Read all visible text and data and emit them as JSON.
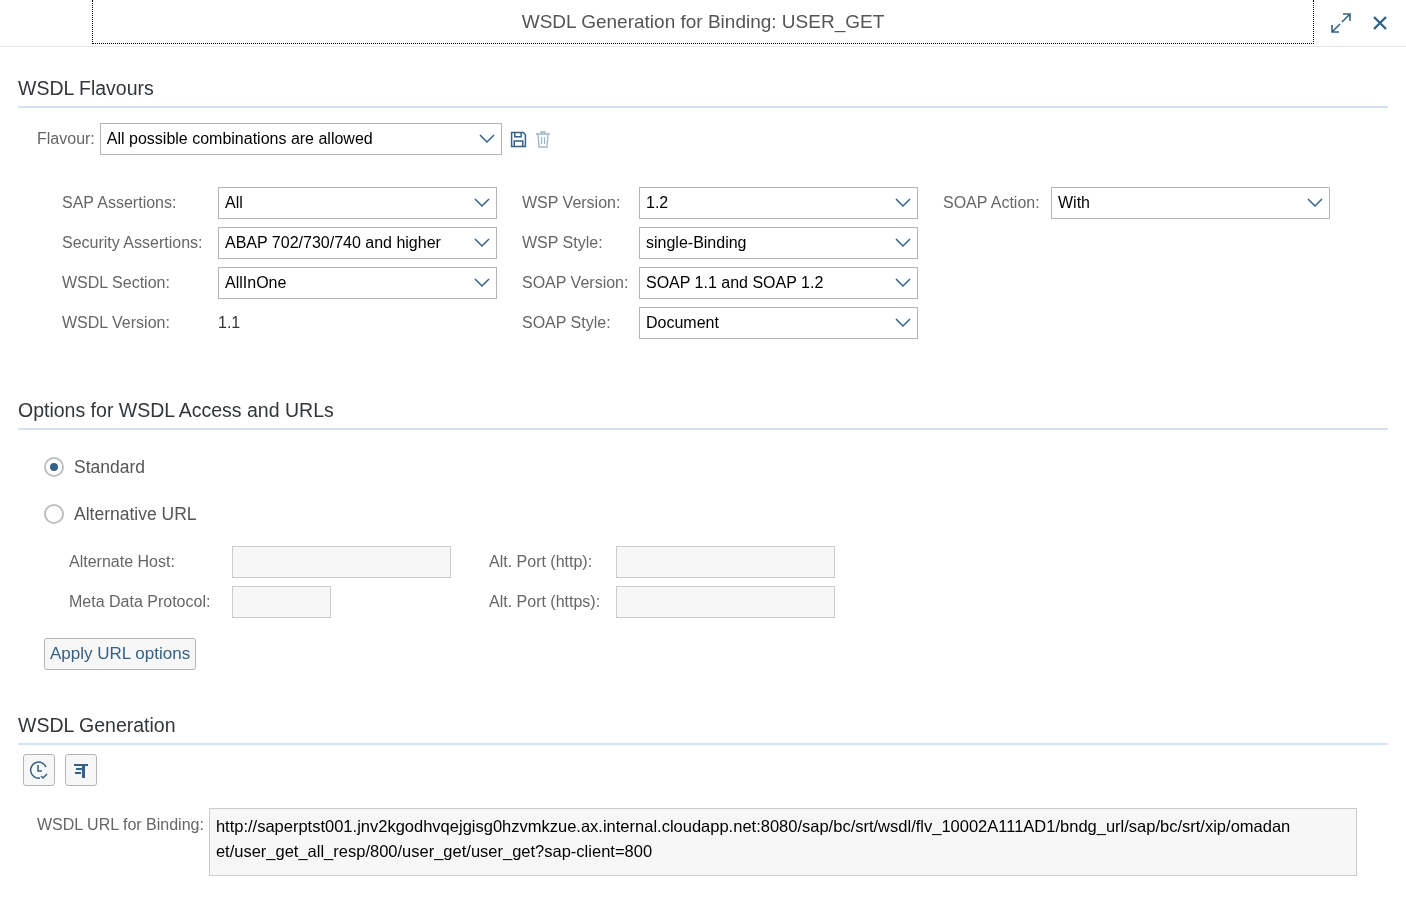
{
  "window": {
    "title": "WSDL Generation for Binding: USER_GET"
  },
  "flavours": {
    "heading": "WSDL Flavours",
    "flavour": {
      "label": "Flavour:",
      "value": "All possible combinations are allowed"
    },
    "columns": [
      [
        {
          "kind": "dropdown",
          "label": "SAP Assertions:",
          "value": "All"
        },
        {
          "kind": "dropdown",
          "label": "Security Assertions:",
          "value": "ABAP 702/730/740 and higher"
        },
        {
          "kind": "dropdown",
          "label": "WSDL Section:",
          "value": "AllInOne"
        },
        {
          "kind": "text",
          "label": "WSDL Version:",
          "value": "1.1"
        }
      ],
      [
        {
          "kind": "dropdown",
          "label": "WSP Version:",
          "value": "1.2"
        },
        {
          "kind": "dropdown",
          "label": "WSP Style:",
          "value": "single-Binding"
        },
        {
          "kind": "dropdown",
          "label": "SOAP Version:",
          "value": "SOAP 1.1 and SOAP 1.2"
        },
        {
          "kind": "dropdown",
          "label": "SOAP Style:",
          "value": "Document"
        }
      ],
      [
        {
          "kind": "dropdown",
          "label": "SOAP Action:",
          "value": "With"
        }
      ]
    ]
  },
  "access": {
    "heading": "Options for WSDL Access and URLs",
    "options": [
      {
        "label": "Standard",
        "selected": true
      },
      {
        "label": "Alternative URL",
        "selected": false
      }
    ],
    "columns": [
      [
        {
          "label": "Alternate Host:"
        },
        {
          "label": "Meta Data Protocol:"
        }
      ],
      [
        {
          "label": "Alt. Port (http):"
        },
        {
          "label": "Alt. Port (https):"
        }
      ]
    ],
    "button": "Apply URL options"
  },
  "generation": {
    "heading": "WSDL Generation",
    "url": {
      "label": "WSDL URL for Binding:",
      "value": "http://saperptst001.jnv2kgodhvqejgisg0hzvmkzue.ax.internal.cloudapp.net:8080/sap/bc/srt/wsdl/flv_10002A111AD1/bndg_url/sap/bc/srt/xip/omadanet/user_get_all_resp/800/user_get/user_get?sap-client=800"
    }
  }
}
